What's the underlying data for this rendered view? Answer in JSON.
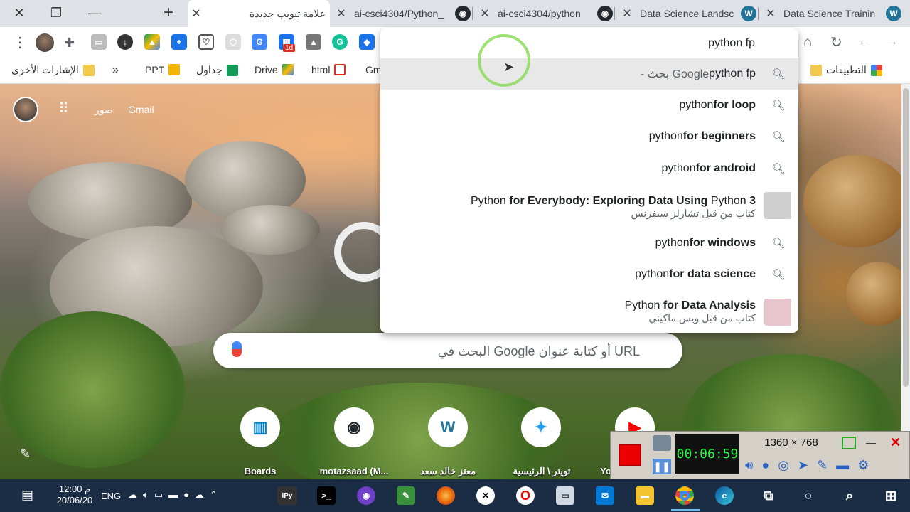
{
  "tabs": [
    {
      "title": "علامة تبويب جديدة",
      "active": true
    },
    {
      "title": "ai-csci4304/Python_",
      "icon": "github-icon"
    },
    {
      "title": "ai-csci4304/python",
      "icon": "github-icon"
    },
    {
      "title": "Data Science Landsc",
      "icon": "wordpress-icon"
    },
    {
      "title": "Data Science Trainin",
      "icon": "wordpress-icon"
    }
  ],
  "omnibox": {
    "query": "python fp",
    "suggestions": [
      {
        "text": "python fp",
        "bold": "",
        "suffix": " - بحث Google",
        "type": "search",
        "highlighted": true
      },
      {
        "text": "python ",
        "bold": "for loop",
        "type": "search"
      },
      {
        "text": "python ",
        "bold": "for beginners",
        "type": "search"
      },
      {
        "text": "python ",
        "bold": "for android",
        "type": "search"
      },
      {
        "text": "Python ",
        "bold": "for Everybody: Exploring Data Using",
        "after": " Python ",
        "bold2": "3",
        "sub": "كتاب من قبل تشارلز سيفرنس",
        "type": "book",
        "thumb_color": "#cfcfcf"
      },
      {
        "text": "python ",
        "bold": "for windows",
        "type": "search"
      },
      {
        "text": "python ",
        "bold": "for data science",
        "type": "search"
      },
      {
        "text": "Python ",
        "bold": "for Data Analysis",
        "sub": "كتاب من قبل ويس ماكيني",
        "type": "book",
        "thumb_color": "#e8c4cc"
      }
    ]
  },
  "bookmarks": {
    "other": "الإشارات الأخرى",
    "more": "»",
    "items": [
      "PPT",
      "جداول",
      "Drive",
      "html",
      "Gm"
    ],
    "apps": "التطبيقات"
  },
  "ntp": {
    "gmail": "Gmail",
    "images": "صور",
    "search_placeholder": "البحث في Google أو كتابة عنوان URL",
    "shortcuts": [
      {
        "label": "Boards",
        "icon": "trello-icon"
      },
      {
        "label": "motazsaad (M...",
        "icon": "github-icon"
      },
      {
        "label": "معتز خالد سعد",
        "icon": "wordpress-icon"
      },
      {
        "label": "تويتر \\ الرئيسية",
        "icon": "twitter-icon"
      },
      {
        "label": "Yo",
        "icon": "youtube-icon"
      }
    ]
  },
  "recorder": {
    "timer": "00:06:59",
    "resolution": "1360 × 768"
  },
  "taskbar": {
    "time": "12:00 م",
    "date": "20/06/20",
    "lang": "ENG",
    "ipy": "IPy"
  }
}
